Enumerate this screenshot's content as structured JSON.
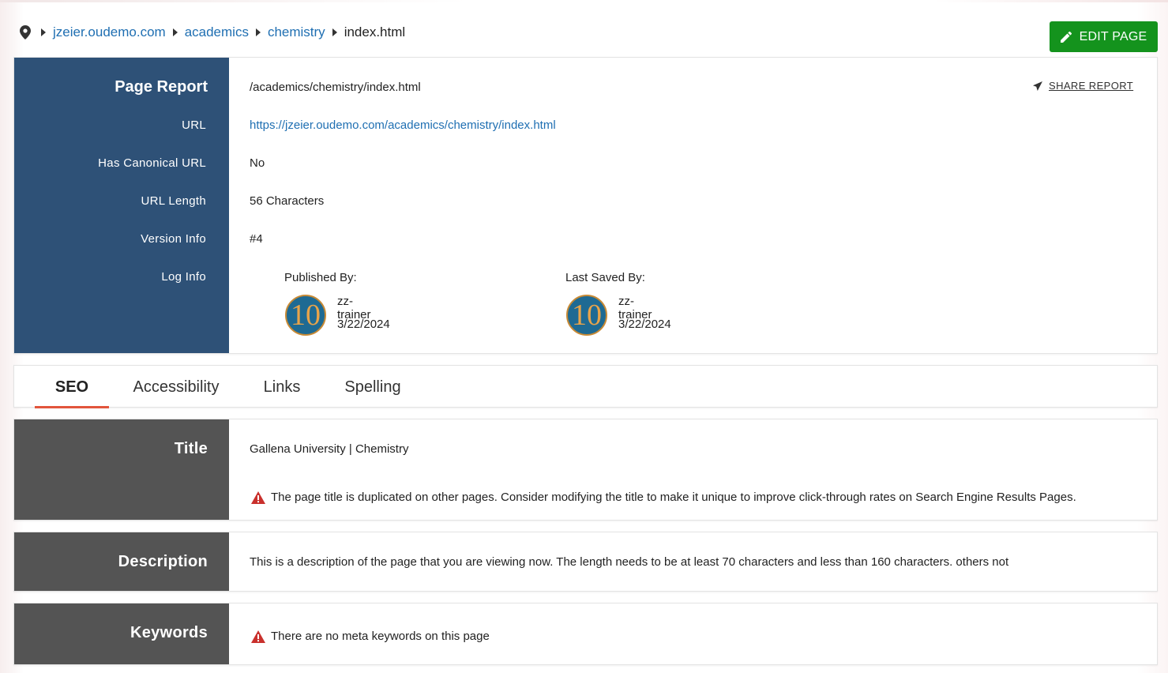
{
  "breadcrumb": {
    "items": [
      "jzeier.oudemo.com",
      "academics",
      "chemistry"
    ],
    "current": "index.html"
  },
  "actions": {
    "edit_page": "EDIT PAGE",
    "share_report": "SHARE REPORT"
  },
  "report": {
    "heading": "Page Report",
    "path": "/academics/chemistry/index.html",
    "labels": {
      "url": "URL",
      "canonical": "Has Canonical URL",
      "length": "URL Length",
      "version": "Version Info",
      "log": "Log Info"
    },
    "url": "https://jzeier.oudemo.com/academics/chemistry/index.html",
    "canonical": "No",
    "length": "56 Characters",
    "version": "#4",
    "log": {
      "published": {
        "caption": "Published By:",
        "avatar": "10",
        "user": "zz-trainer",
        "date": "3/22/2024"
      },
      "saved": {
        "caption": "Last Saved By:",
        "avatar": "10",
        "user": "zz-trainer",
        "date": "3/22/2024"
      }
    }
  },
  "tabs": [
    "SEO",
    "Accessibility",
    "Links",
    "Spelling"
  ],
  "seo": {
    "title": {
      "label": "Title",
      "value": "Gallena University | Chemistry",
      "warning": "The page title is duplicated on other pages. Consider modifying the title to make it unique to improve click-through rates on Search Engine Results Pages."
    },
    "description": {
      "label": "Description",
      "value": "This is a description of the page that you are viewing now. The length needs to be at least 70 characters and less than 160 characters. others not"
    },
    "keywords": {
      "label": "Keywords",
      "warning": "There are no meta keywords on this page"
    }
  },
  "colors": {
    "sidebar_blue": "#2e5177",
    "sidebar_gray": "#545454",
    "edit_green": "#14931d",
    "link_blue": "#1f6fb2",
    "tab_underline": "#e2553c",
    "warning_red": "#c9302c"
  },
  "icons": [
    "map-pin-icon",
    "pencil-icon",
    "paper-plane-icon",
    "warning-icon"
  ]
}
